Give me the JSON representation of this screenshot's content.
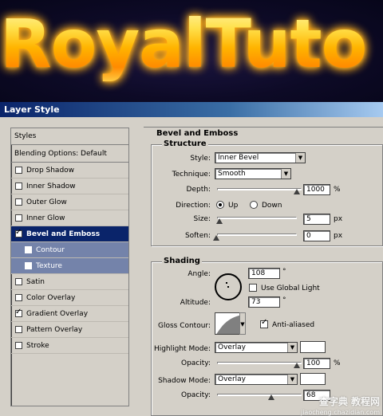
{
  "banner": {
    "title": "RoyalTuto"
  },
  "dialog": {
    "title": "Layer Style"
  },
  "styles_panel": {
    "header": "Styles",
    "blending_options": "Blending Options: Default",
    "items": [
      {
        "label": "Drop Shadow",
        "checked": false
      },
      {
        "label": "Inner Shadow",
        "checked": false
      },
      {
        "label": "Outer Glow",
        "checked": false
      },
      {
        "label": "Inner Glow",
        "checked": false
      },
      {
        "label": "Bevel and Emboss",
        "checked": true
      },
      {
        "label": "Contour",
        "checked": false
      },
      {
        "label": "Texture",
        "checked": false
      },
      {
        "label": "Satin",
        "checked": false
      },
      {
        "label": "Color Overlay",
        "checked": false
      },
      {
        "label": "Gradient Overlay",
        "checked": true
      },
      {
        "label": "Pattern Overlay",
        "checked": false
      },
      {
        "label": "Stroke",
        "checked": false
      }
    ]
  },
  "bevel": {
    "title": "Bevel and Emboss",
    "structure": {
      "label": "Structure",
      "style_label": "Style:",
      "style_value": "Inner Bevel",
      "technique_label": "Technique:",
      "technique_value": "Smooth",
      "depth_label": "Depth:",
      "depth_value": "1000",
      "depth_unit": "%",
      "direction_label": "Direction:",
      "direction_up": "Up",
      "direction_down": "Down",
      "size_label": "Size:",
      "size_value": "5",
      "size_unit": "px",
      "soften_label": "Soften:",
      "soften_value": "0",
      "soften_unit": "px"
    },
    "shading": {
      "label": "Shading",
      "angle_label": "Angle:",
      "angle_value": "108",
      "angle_unit": "°",
      "global_light_label": "Use Global Light",
      "global_light": false,
      "altitude_label": "Altitude:",
      "altitude_value": "73",
      "altitude_unit": "°",
      "gloss_label": "Gloss Contour:",
      "anti_aliased_label": "Anti-aliased",
      "anti_aliased": true,
      "highlight_mode_label": "Highlight Mode:",
      "highlight_mode_value": "Overlay",
      "highlight_opacity_label": "Opacity:",
      "highlight_opacity_value": "100",
      "highlight_opacity_unit": "%",
      "shadow_mode_label": "Shadow Mode:",
      "shadow_mode_value": "Overlay",
      "shadow_opacity_label": "Opacity:",
      "shadow_opacity_value": "68"
    }
  },
  "watermark": {
    "main": "查字典 教程网",
    "sub": "jiaocheng.chazidian.com"
  }
}
